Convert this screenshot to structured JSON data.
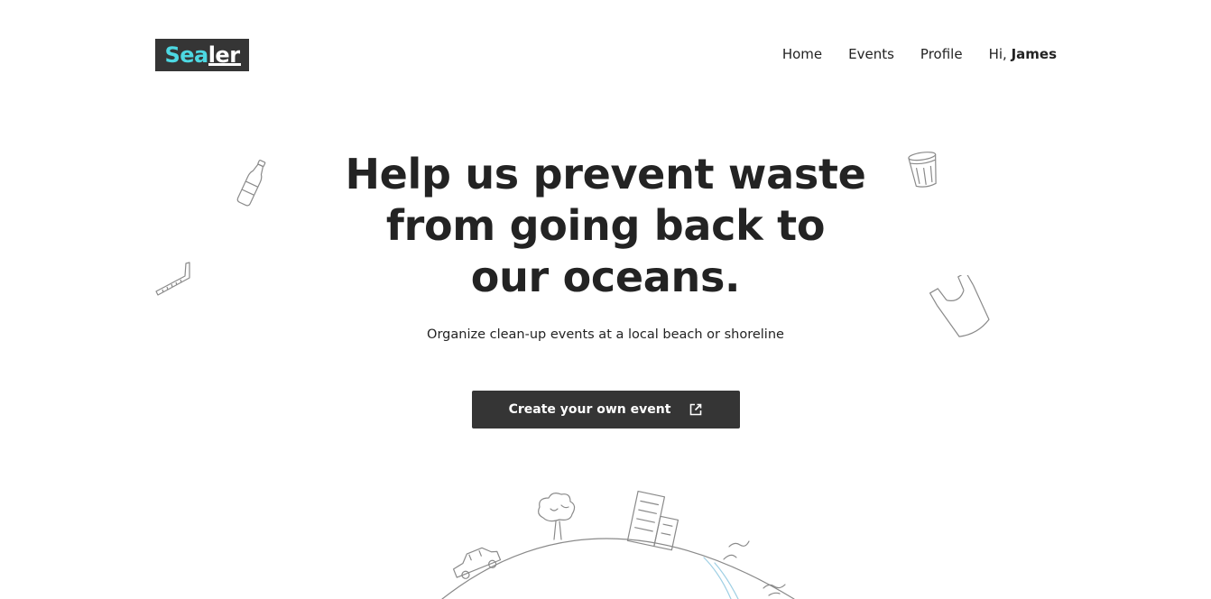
{
  "header": {
    "logo_part1": "Sea",
    "logo_part2": "ler",
    "nav": {
      "home": "Home",
      "events": "Events",
      "profile": "Profile",
      "greeting_prefix": "Hi,",
      "user_name": "James"
    }
  },
  "hero": {
    "title_line1": "Help us prevent waste",
    "title_line2": "from going back to",
    "title_line3": "our oceans.",
    "subtitle": "Organize clean-up events at a local beach or shoreline",
    "cta_label": "Create your own event"
  },
  "colors": {
    "dark": "#353535",
    "logo_accent": "#4dd8e2",
    "text": "#232323",
    "doodle_stroke": "#8a8a8a",
    "water_accent": "#9ecfe4"
  },
  "icons": {
    "cta_icon": "external-link-icon",
    "doodles": [
      "bottle-icon",
      "straw-icon",
      "cup-icon",
      "plastic-bag-icon",
      "globe-illustration"
    ]
  }
}
